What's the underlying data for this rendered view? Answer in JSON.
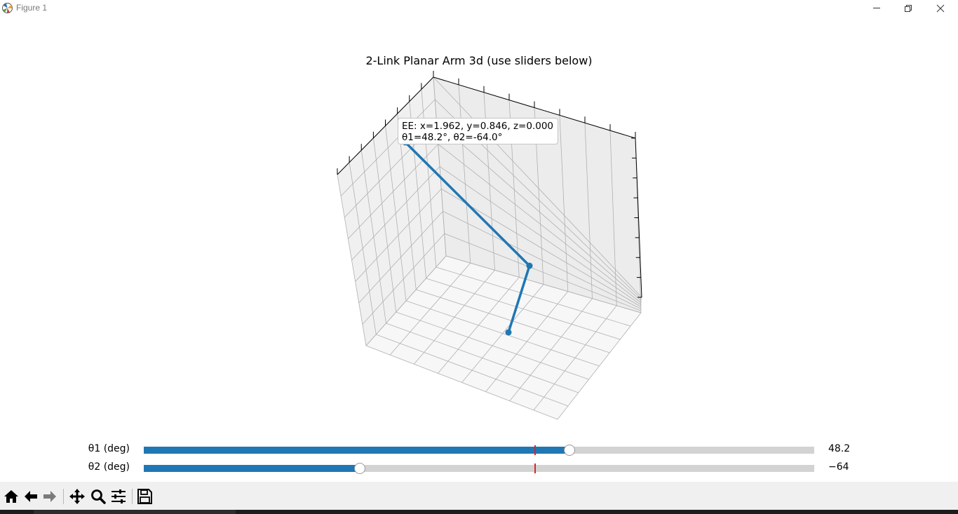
{
  "window": {
    "title": "Figure 1",
    "icon": "matplotlib-logo-icon",
    "controls": [
      "minimize-icon",
      "restore-icon",
      "close-icon"
    ]
  },
  "plot": {
    "title": "2-Link Planar Arm 3d (use sliders below)",
    "arm_color": "#1f77b4",
    "annotation": {
      "line1": "EE: x=1.962, y=0.846, z=0.000",
      "line2": "θ1=48.2°, θ2=-64.0°"
    }
  },
  "sliders": [
    {
      "label": "θ1 (deg)",
      "value_text": "48.2",
      "fraction": 0.635,
      "valinit_fraction": 0.584
    },
    {
      "label": "θ2 (deg)",
      "value_text": "−64",
      "fraction": 0.322,
      "valinit_fraction": 0.584
    }
  ],
  "colors": {
    "slider_fill": "#1f77b4",
    "slider_track": "#d3d3d3",
    "valinit_marker": "#d62728",
    "pane": "#f2f2f2",
    "grid": "#b0b0b0"
  },
  "toolbar": {
    "items": [
      "home-icon",
      "back-icon",
      "forward-icon",
      "pan-icon",
      "zoom-icon",
      "configure-subplots-icon",
      "save-icon"
    ]
  }
}
